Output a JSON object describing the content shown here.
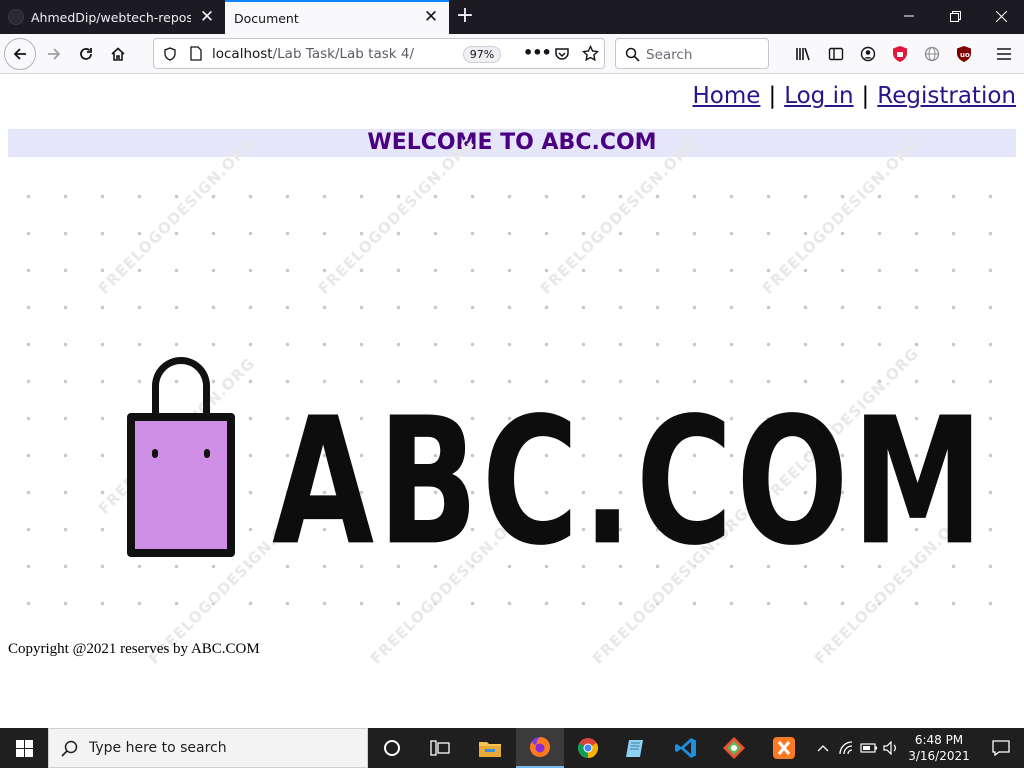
{
  "browser": {
    "tabs": [
      {
        "title": "AhmedDip/webtech-repository",
        "active": false
      },
      {
        "title": "Document",
        "active": true
      }
    ],
    "url_host": "localhost",
    "url_path": "/Lab Task/Lab task 4/",
    "zoom": "97%",
    "search_placeholder": "Search"
  },
  "page": {
    "nav": {
      "home": "Home",
      "login": "Log in",
      "registration": "Registration",
      "separator": "|"
    },
    "welcome": "WELCOME TO ABC.COM",
    "logo_text": "ABC.COM",
    "watermark": "FREELOGODESIGN.ORG",
    "footer": "Copyright @2021 reserves by ABC.COM"
  },
  "taskbar": {
    "search_placeholder": "Type here to search",
    "time": "6:48 PM",
    "date": "3/16/2021"
  },
  "colors": {
    "welcome_bg": "#e6e6fa",
    "welcome_text": "#4b0082",
    "link": "#26168c",
    "bag": "#d08fe6"
  }
}
